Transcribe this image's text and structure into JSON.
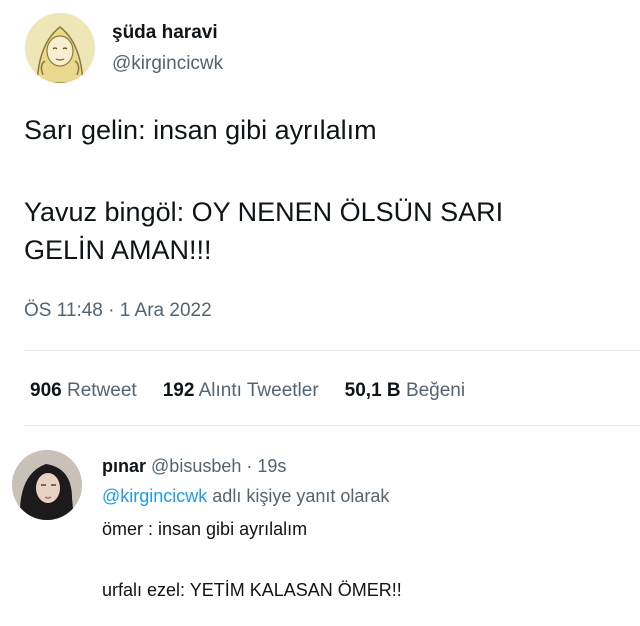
{
  "tweet": {
    "display_name": "şüda haravi",
    "handle": "@kirgincicwk",
    "text_line1": "Sarı gelin: insan gibi ayrılalım",
    "text_line2": "Yavuz bingöl: OY NENEN ÖLSÜN SARI",
    "text_line3": "GELİN AMAN!!!",
    "timestamp": "ÖS 11:48 · 1 Ara 2022",
    "stats": {
      "retweets_count": "906",
      "retweets_label": "Retweet",
      "quotes_count": "192",
      "quotes_label": "Alıntı Tweetler",
      "likes_count": "50,1 B",
      "likes_label": "Beğeni"
    }
  },
  "reply": {
    "display_name": "pınar",
    "handle": "@bisusbeh",
    "separator": "·",
    "age": "19s",
    "reply_to_mention": "@kirgincicwk",
    "reply_to_suffix": " adlı kişiye yanıt olarak",
    "text_line1": "ömer : insan gibi ayrılalım",
    "text_line2": "urfalı ezel: YETİM KALASAN ÖMER!!"
  },
  "colors": {
    "text": "#0f1419",
    "secondary": "#536471",
    "link": "#1d9bf0",
    "divider": "#e6ecf0"
  }
}
